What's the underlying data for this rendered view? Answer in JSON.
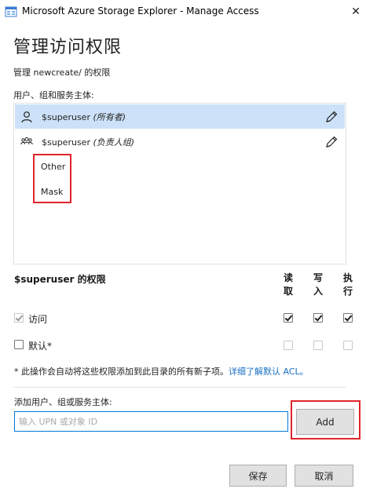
{
  "window": {
    "title": "Microsoft Azure Storage Explorer - Manage Access",
    "close_glyph": "✕"
  },
  "page": {
    "title": "管理访问权限",
    "subtitle": "管理 newcreate/ 的权限",
    "users_label": "用户、组和服务主体:"
  },
  "principals": [
    {
      "name": "$superuser",
      "role": "(所有者)",
      "selected": true,
      "icon": "user-icon"
    },
    {
      "name": "$superuser",
      "role": "(负责人组)",
      "selected": false,
      "icon": "group-icon"
    }
  ],
  "entries": [
    "Other",
    "Mask"
  ],
  "permissions": {
    "title": "$superuser 的权限",
    "columns": [
      "读取",
      "写入",
      "执行"
    ],
    "rows": [
      {
        "label": "访问",
        "enabled": true,
        "checked": true,
        "values": [
          true,
          true,
          true
        ]
      },
      {
        "label": "默认*",
        "enabled": true,
        "checked": false,
        "values": [
          false,
          false,
          false
        ]
      }
    ]
  },
  "note": {
    "text": "* 此操作会自动将这些权限添加到此目录的所有新子项。",
    "link": "详细了解默认 ACL。"
  },
  "add": {
    "label": "添加用户、组或服务主体:",
    "placeholder": "输入 UPN 或对象 ID",
    "button": "Add"
  },
  "footer": {
    "save": "保存",
    "cancel": "取消"
  },
  "colors": {
    "accent": "#0078d7",
    "selection": "#cde1f8",
    "highlight": "#e0242b",
    "link": "#1a6fc4"
  }
}
